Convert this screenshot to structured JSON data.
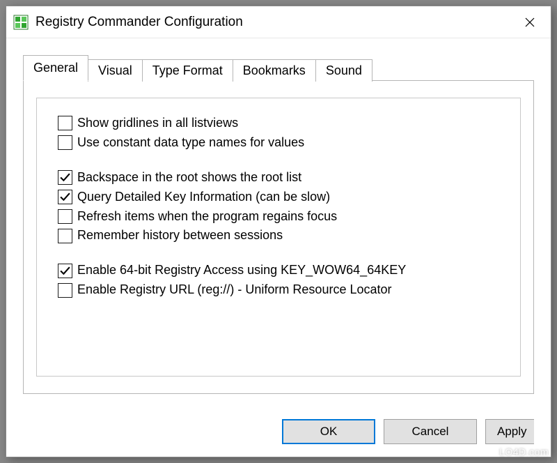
{
  "window": {
    "title": "Registry Commander Configuration"
  },
  "tabs": [
    {
      "label": "General",
      "active": true
    },
    {
      "label": "Visual",
      "active": false
    },
    {
      "label": "Type Format",
      "active": false
    },
    {
      "label": "Bookmarks",
      "active": false
    },
    {
      "label": "Sound",
      "active": false
    }
  ],
  "options": [
    [
      {
        "label": "Show gridlines in all listviews",
        "checked": false
      },
      {
        "label": "Use constant data type names for values",
        "checked": false
      }
    ],
    [
      {
        "label": "Backspace in the root shows the root list",
        "checked": true
      },
      {
        "label": "Query Detailed Key Information (can be slow)",
        "checked": true
      },
      {
        "label": "Refresh items when the program regains focus",
        "checked": false
      },
      {
        "label": "Remember history between sessions",
        "checked": false
      }
    ],
    [
      {
        "label": "Enable 64-bit Registry Access using KEY_WOW64_64KEY",
        "checked": true
      },
      {
        "label": "Enable Registry URL (reg://) - Uniform Resource Locator",
        "checked": false
      }
    ]
  ],
  "buttons": {
    "ok": "OK",
    "cancel": "Cancel",
    "apply": "Apply"
  },
  "watermark": "LO4D.com"
}
